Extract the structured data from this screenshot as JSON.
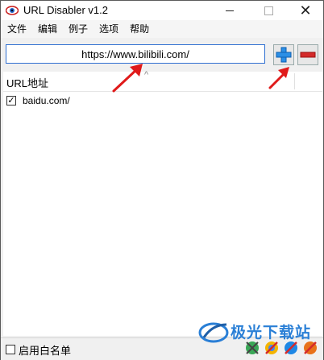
{
  "window": {
    "title": "URL Disabler v1.2"
  },
  "menu": [
    "文件",
    "编辑",
    "例子",
    "选项",
    "帮助"
  ],
  "toolbar": {
    "url_value": "https://www.bilibili.com/"
  },
  "list": {
    "column_header": "URL地址",
    "rows": [
      {
        "label": "baidu.com/",
        "checked": true
      }
    ]
  },
  "status": {
    "whitelist_label": "启用白名单",
    "whitelist_checked": false
  },
  "watermark": {
    "text": "极光下载站"
  },
  "colors": {
    "accent": "#2f6fd1",
    "arrow": "#e01a1a",
    "add": "#1e90ff",
    "remove": "#d42a2a"
  }
}
